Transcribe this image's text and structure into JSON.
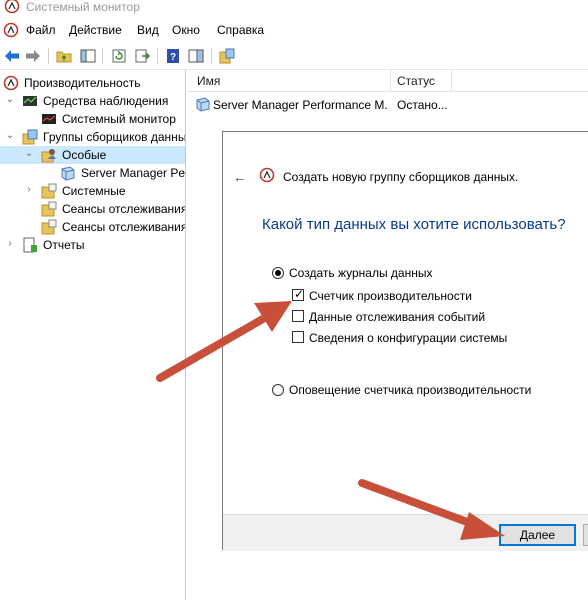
{
  "window": {
    "title": "Системный монитор"
  },
  "menu": [
    "Файл",
    "Действие",
    "Вид",
    "Окно",
    "Справка"
  ],
  "tree": {
    "performance": "Производительность",
    "monitoring_tools": "Средства наблюдения",
    "system_monitor": "Системный монитор",
    "collector_sets": "Группы сборщиков данных",
    "user_defined": "Особые",
    "server_manager_set": "Server Manager Performance Monitor",
    "system": "Системные",
    "event_trace": "Сеансы отслеживания событий",
    "startup_event_trace": "Сеансы отслеживания событий запуска",
    "reports": "Отчеты"
  },
  "list": {
    "columns": [
      "Имя",
      "Статус"
    ],
    "rows": [
      {
        "name": "Server Manager Performance M...",
        "status": "Остано..."
      }
    ]
  },
  "wizard": {
    "title": "Создать новую группу сборщиков данных.",
    "question": "Какой тип данных вы хотите использовать?",
    "option_logs": "Создать журналы данных",
    "performance_counter": "Счетчик производительности",
    "event_trace_data": "Данные отслеживания событий",
    "system_config": "Сведения о конфигурации системы",
    "option_alert": "Оповещение счетчика производительности",
    "next_button": "Далее"
  }
}
